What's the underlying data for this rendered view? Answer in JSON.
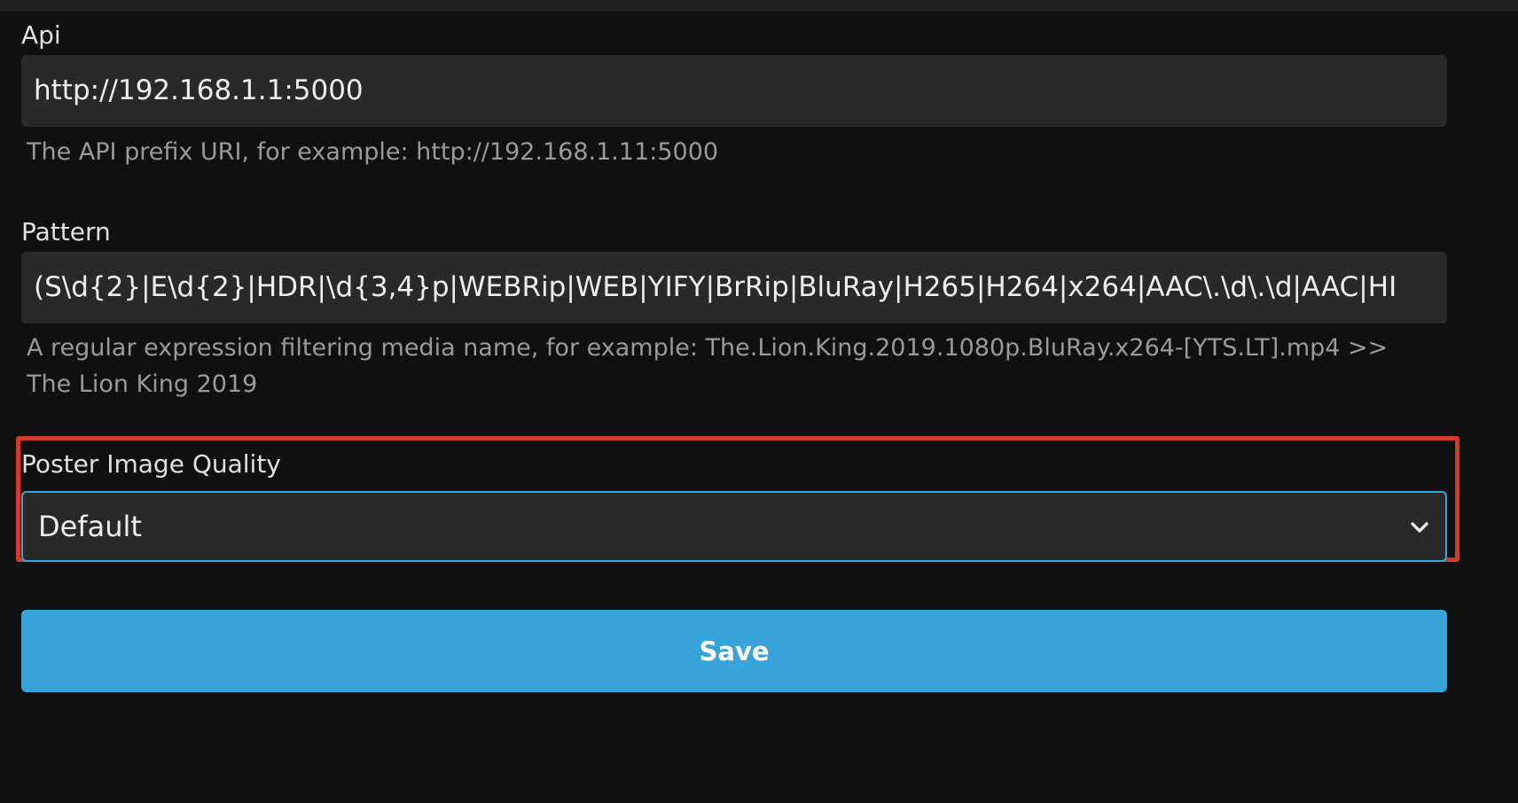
{
  "api": {
    "label": "Api",
    "value": "http://192.168.1.1:5000",
    "help": "The API prefix URI, for example: http://192.168.1.11:5000"
  },
  "pattern": {
    "label": "Pattern",
    "value": "(S\\d{2}|E\\d{2}|HDR|\\d{3,4}p|WEBRip|WEB|YIFY|BrRip|BluRay|H265|H264|x264|AAC\\.\\d\\.\\d|AAC|HI",
    "help_line1": "A regular expression filtering media name, for example: The.Lion.King.2019.1080p.BluRay.x264-[YTS.LT].mp4 >>",
    "help_line2": "The Lion King 2019"
  },
  "poster_quality": {
    "label": "Poster Image Quality",
    "selected": "Default",
    "highlighted": true
  },
  "save_button": {
    "label": "Save"
  },
  "colors": {
    "background": "#101010",
    "input_bg": "#292929",
    "accent": "#37a3d8",
    "highlight_border": "#d33a2c",
    "help_text": "#9a9a9a"
  }
}
